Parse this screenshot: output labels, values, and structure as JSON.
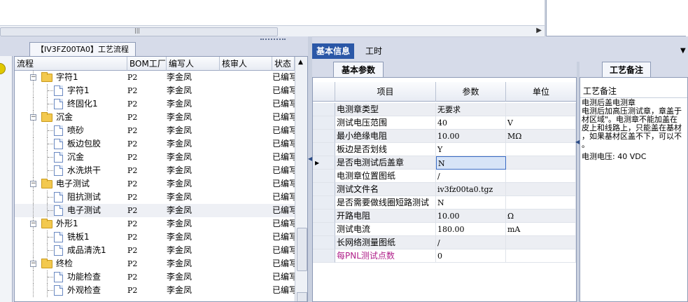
{
  "top": {
    "scroll_grip": "|||",
    "scroll_arrow": "▶"
  },
  "left": {
    "flow_tab": "【IV3FZ00TA0】工艺流程",
    "columns": [
      "流程",
      "BOM工厂",
      "编写人",
      "核审人",
      "状态"
    ],
    "rows": [
      {
        "level": 1,
        "kind": "folder",
        "label": "字符1",
        "bom": "P2",
        "author": "李金凤",
        "status": "已编写"
      },
      {
        "level": 2,
        "kind": "doc",
        "label": "字符1",
        "bom": "P2",
        "author": "李金凤",
        "status": "已编写"
      },
      {
        "level": 2,
        "kind": "doc",
        "label": "终固化1",
        "bom": "P2",
        "author": "李金凤",
        "status": "已编写"
      },
      {
        "level": 1,
        "kind": "folder",
        "label": "沉金",
        "bom": "P2",
        "author": "李金凤",
        "status": "已编写"
      },
      {
        "level": 2,
        "kind": "doc",
        "label": "喷砂",
        "bom": "P2",
        "author": "李金凤",
        "status": "已编写"
      },
      {
        "level": 2,
        "kind": "doc",
        "label": "板边包胶",
        "bom": "P2",
        "author": "李金凤",
        "status": "已编写"
      },
      {
        "level": 2,
        "kind": "doc",
        "label": "沉金",
        "bom": "P2",
        "author": "李金凤",
        "status": "已编写"
      },
      {
        "level": 2,
        "kind": "doc",
        "label": "水洗烘干",
        "bom": "P2",
        "author": "李金凤",
        "status": "已编写"
      },
      {
        "level": 1,
        "kind": "folder",
        "label": "电子测试",
        "bom": "P2",
        "author": "李金凤",
        "status": "已编写"
      },
      {
        "level": 2,
        "kind": "doc",
        "label": "阻抗测试",
        "bom": "P2",
        "author": "李金凤",
        "status": "已编写"
      },
      {
        "level": 2,
        "kind": "doc",
        "label": "电子测试",
        "bom": "P2",
        "author": "李金凤",
        "status": "已编写",
        "selected": true
      },
      {
        "level": 1,
        "kind": "folder",
        "label": "外形1",
        "bom": "P2",
        "author": "李金凤",
        "status": "已编写"
      },
      {
        "level": 2,
        "kind": "doc",
        "label": "铣板1",
        "bom": "P2",
        "author": "李金凤",
        "status": "已编写"
      },
      {
        "level": 2,
        "kind": "doc",
        "label": "成品清洗1",
        "bom": "P2",
        "author": "李金凤",
        "status": "已编写"
      },
      {
        "level": 1,
        "kind": "folder",
        "label": "终检",
        "bom": "P2",
        "author": "李金凤",
        "status": "已编写"
      },
      {
        "level": 2,
        "kind": "doc",
        "label": "功能检查",
        "bom": "P2",
        "author": "李金凤",
        "status": "已编写"
      },
      {
        "level": 2,
        "kind": "doc",
        "label": "外观检查",
        "bom": "P2",
        "author": "李金凤",
        "status": "已编写"
      }
    ]
  },
  "right": {
    "tabs": [
      "基本信息",
      "工时"
    ],
    "menu_glyph": "▼",
    "subtab_params": "基本参数",
    "subtab_notes": "工艺备注",
    "columns": [
      "项目",
      "参数",
      "单位"
    ],
    "rows": [
      {
        "name": "电测章类型",
        "param": "无要求",
        "unit": ""
      },
      {
        "name": "测试电压范围",
        "param": "40",
        "unit": "V"
      },
      {
        "name": "最小绝缘电阻",
        "param": "10.00",
        "unit": "MΩ"
      },
      {
        "name": "板边是否划线",
        "param": "Y",
        "unit": ""
      },
      {
        "name": "是否电测试后盖章",
        "param": "N",
        "unit": "",
        "current": true
      },
      {
        "name": "电测章位置图纸",
        "param": "/",
        "unit": ""
      },
      {
        "name": "测试文件名",
        "param": "iv3fz00ta0.tgz",
        "unit": ""
      },
      {
        "name": "是否需要做线圈短路测试",
        "param": "N",
        "unit": ""
      },
      {
        "name": "开路电阻",
        "param": "10.00",
        "unit": "Ω"
      },
      {
        "name": "测试电流",
        "param": "180.00",
        "unit": "mA"
      },
      {
        "name": "长网络测量图纸",
        "param": "/",
        "unit": ""
      },
      {
        "name": "每PNL测试点数",
        "param": "0",
        "unit": "",
        "magenta": true
      }
    ],
    "notes_label": "工艺备注",
    "notes_text": "电测后盖电测章\n电测后加高压测试章，章盖于\n材区域\"。电测章不能加盖在\n皮上和线路上，只能盖在基材\n，如果基材区盖不下，可以不\n。",
    "notes_voltage": "电测电压: 40 VDC"
  }
}
